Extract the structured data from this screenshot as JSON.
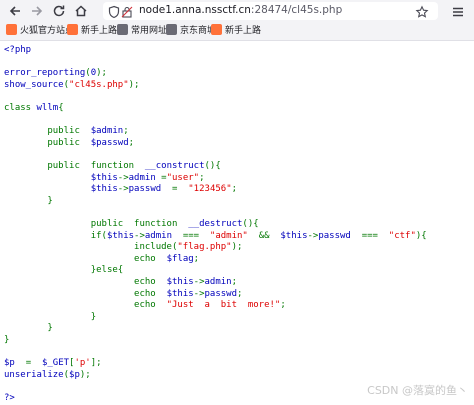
{
  "browser": {
    "url_host": "node1.anna.nssctf.cn",
    "url_rest": ":28474/cl45s.php"
  },
  "bookmarks": [
    {
      "label": "火狐官方站点",
      "color": "#ff7139"
    },
    {
      "label": "新手上路",
      "color": "#ff7139"
    },
    {
      "label": "常用网址",
      "color": "#6b6b75"
    },
    {
      "label": "京东商城",
      "color": "#6b6b75"
    },
    {
      "label": "新手上路",
      "color": "#ff7139"
    }
  ],
  "code_lines": [
    [
      [
        "hl",
        "<?php"
      ]
    ],
    [],
    [
      [
        "hl",
        "error_reporting"
      ],
      [
        "kw",
        "("
      ],
      [
        "hl",
        "0"
      ],
      [
        "kw",
        ");"
      ]
    ],
    [
      [
        "hl",
        "show_source"
      ],
      [
        "kw",
        "("
      ],
      [
        "st",
        "\"cl45s.php\""
      ],
      [
        "kw",
        ");"
      ]
    ],
    [],
    [
      [
        "kw",
        "class "
      ],
      [
        "hl",
        "wllm"
      ],
      [
        "kw",
        "{"
      ]
    ],
    [],
    [
      [
        "kw",
        "        public  "
      ],
      [
        "hl",
        "$admin"
      ],
      [
        "kw",
        ";"
      ]
    ],
    [
      [
        "kw",
        "        public  "
      ],
      [
        "hl",
        "$passwd"
      ],
      [
        "kw",
        ";"
      ]
    ],
    [],
    [
      [
        "kw",
        "        public  function  "
      ],
      [
        "hl",
        "__construct"
      ],
      [
        "kw",
        "(){"
      ]
    ],
    [
      [
        "hl",
        "                $this"
      ],
      [
        "kw",
        "->"
      ],
      [
        "hl",
        "admin "
      ],
      [
        "kw",
        "="
      ],
      [
        "st",
        "\"user\""
      ],
      [
        "kw",
        ";"
      ]
    ],
    [
      [
        "hl",
        "                $this"
      ],
      [
        "kw",
        "->"
      ],
      [
        "hl",
        "passwd  "
      ],
      [
        "kw",
        "=  "
      ],
      [
        "st",
        "\"123456\""
      ],
      [
        "kw",
        ";"
      ]
    ],
    [
      [
        "kw",
        "        }"
      ]
    ],
    [],
    [
      [
        "kw",
        "                public  function  "
      ],
      [
        "hl",
        "__destruct"
      ],
      [
        "kw",
        "(){"
      ]
    ],
    [
      [
        "kw",
        "                if("
      ],
      [
        "hl",
        "$this"
      ],
      [
        "kw",
        "->"
      ],
      [
        "hl",
        "admin  "
      ],
      [
        "kw",
        "===  "
      ],
      [
        "st",
        "\"admin\"  "
      ],
      [
        "kw",
        "&&  "
      ],
      [
        "hl",
        "$this"
      ],
      [
        "kw",
        "->"
      ],
      [
        "hl",
        "passwd  "
      ],
      [
        "kw",
        "===  "
      ],
      [
        "st",
        "\"ctf\""
      ],
      [
        "kw",
        "){"
      ]
    ],
    [
      [
        "kw",
        "                        include("
      ],
      [
        "st",
        "\"flag.php\""
      ],
      [
        "kw",
        ");"
      ]
    ],
    [
      [
        "kw",
        "                        echo  "
      ],
      [
        "hl",
        "$flag"
      ],
      [
        "kw",
        ";"
      ]
    ],
    [
      [
        "kw",
        "                }else{"
      ]
    ],
    [
      [
        "kw",
        "                        echo  "
      ],
      [
        "hl",
        "$this"
      ],
      [
        "kw",
        "->"
      ],
      [
        "hl",
        "admin"
      ],
      [
        "kw",
        ";"
      ]
    ],
    [
      [
        "kw",
        "                        echo  "
      ],
      [
        "hl",
        "$this"
      ],
      [
        "kw",
        "->"
      ],
      [
        "hl",
        "passwd"
      ],
      [
        "kw",
        ";"
      ]
    ],
    [
      [
        "kw",
        "                        echo  "
      ],
      [
        "st",
        "\"Just  a  bit  more!\""
      ],
      [
        "kw",
        ";"
      ]
    ],
    [
      [
        "kw",
        "                }"
      ]
    ],
    [
      [
        "kw",
        "        }"
      ]
    ],
    [
      [
        "kw",
        "}"
      ]
    ],
    [],
    [
      [
        "hl",
        "$p  "
      ],
      [
        "kw",
        "=  "
      ],
      [
        "hl",
        "$_GET"
      ],
      [
        "kw",
        "["
      ],
      [
        "st",
        "'p'"
      ],
      [
        "kw",
        "];"
      ]
    ],
    [
      [
        "hl",
        "unserialize"
      ],
      [
        "kw",
        "("
      ],
      [
        "hl",
        "$p"
      ],
      [
        "kw",
        ");"
      ]
    ],
    [],
    [
      [
        "hl",
        "?>"
      ]
    ]
  ],
  "watermark": "CSDN @落寞的鱼丶"
}
